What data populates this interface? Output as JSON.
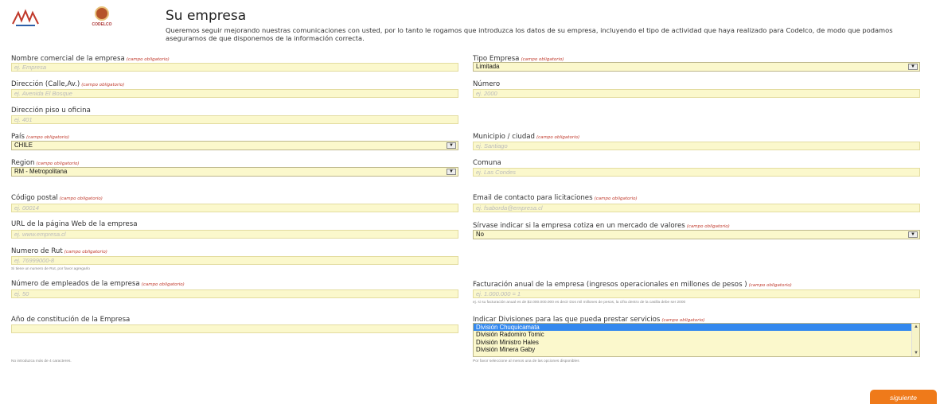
{
  "header": {
    "logo_left_text": "AMSA",
    "logo_right_text": "CODELCO",
    "title": "Su empresa",
    "intro": "Queremos seguir mejorando nuestras comunicaciones con usted, por lo tanto le rogamos que introduzca los datos de su empresa, incluyendo el tipo de actividad que haya realizado para Codelco, de modo que podamos asegurarnos de que disponemos de la información correcta."
  },
  "required_tag": "(campo obligatorio)",
  "fields": {
    "nombre_comercial": {
      "label": "Nombre comercial de la empresa",
      "placeholder": "ej. Empresa"
    },
    "tipo_empresa": {
      "label": "Tipo Empresa",
      "value": "Limitada"
    },
    "direccion": {
      "label": "Dirección (Calle,Av.)",
      "placeholder": "ej. Avenida El Bosque"
    },
    "numero": {
      "label": "Número",
      "placeholder": "ej. 2000"
    },
    "direccion_piso": {
      "label": "Dirección piso u oficina",
      "placeholder": "ej. 401"
    },
    "pais": {
      "label": "País",
      "value": "CHILE"
    },
    "municipio": {
      "label": "Municipio / ciudad",
      "placeholder": "ej. Santiago"
    },
    "region": {
      "label": "Region",
      "value": "RM - Metropolitana"
    },
    "comuna": {
      "label": "Comuna",
      "placeholder": "ej. Las Condes"
    },
    "codigo_postal": {
      "label": "Código postal",
      "placeholder": "ej. 00014"
    },
    "email": {
      "label": "Email de contacto para licitaciones",
      "placeholder": "ej. fsaborda@empresa.cl"
    },
    "url": {
      "label": "URL de la página Web de la empresa",
      "placeholder": "ej. www.empresa.cl"
    },
    "cotiza": {
      "label": "Sírvase indicar si la empresa cotiza en un mercado de valores",
      "value": "No"
    },
    "rut": {
      "label": "Numero de Rut",
      "placeholder": "ej. 76999000-8",
      "help": "Si tiene un numero de Rut, por favor agregarlo"
    },
    "empleados": {
      "label": "Número de empleados de la empresa",
      "placeholder": "ej. 50"
    },
    "facturacion": {
      "label": "Facturación anual de la empresa (ingresos operacionales en millones de pesos )",
      "placeholder": "ej. 1.000.000 = 1",
      "help": "ej. si su facturación anual es de $2.000.000.000 es decir Dos mil millones de pesos, la cifra dentro de la casilla debe ser 2000"
    },
    "ano_constitucion": {
      "label": "Año de constitución de la Empresa",
      "placeholder": "",
      "help": "No introduzca más de 4 caracteres."
    },
    "divisiones": {
      "label": "Indicar Divisiones para las que pueda prestar servicios",
      "options": [
        "División Chuquicamata",
        "División Radomiro Tomic",
        "División Ministro Hales",
        "División Minera Gaby"
      ],
      "help": "Por favor seleccione al menos una de las opciones disponibles"
    }
  },
  "submit_label": "siguiente",
  "icons": {
    "dropdown": "dropdown-arrow-icon",
    "scroll_up": "scroll-up-icon",
    "scroll_down": "scroll-down-icon"
  },
  "colors": {
    "field_bg": "#fbf8cc",
    "accent": "#ef7a1a",
    "required": "#c0392b",
    "selected_option": "#3388ee"
  }
}
